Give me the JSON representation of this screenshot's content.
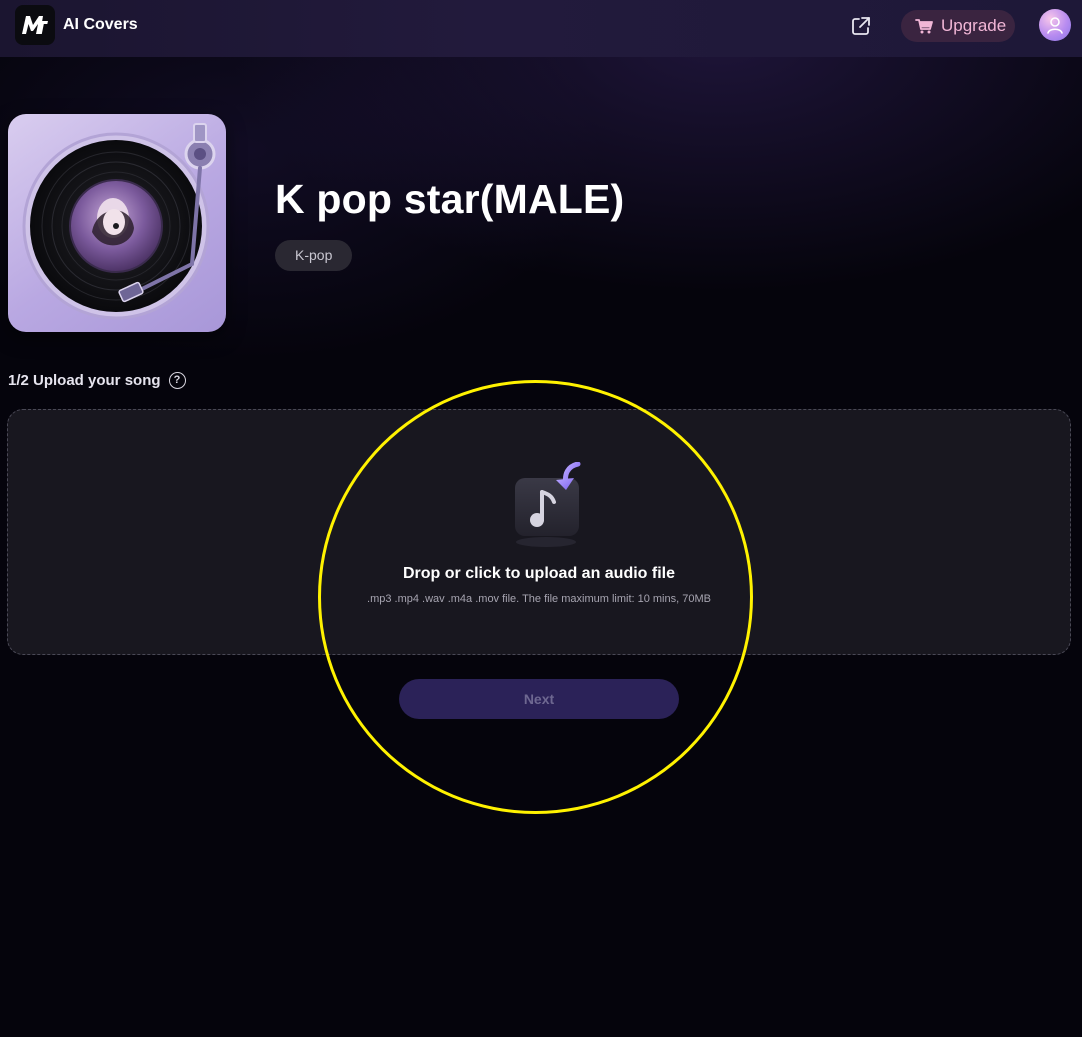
{
  "header": {
    "app_title": "AI Covers",
    "logo_text": "M",
    "upgrade_label": "Upgrade",
    "share_icon": "external-link-icon",
    "cart_icon": "cart-icon",
    "avatar_icon": "user-icon"
  },
  "voice": {
    "title": "K pop star(MALE)",
    "tag": "K-pop",
    "cover_icon": "turntable-record-image"
  },
  "upload": {
    "step_label": "1/2 Upload your song",
    "help_icon_glyph": "?",
    "drop_title": "Drop or click to upload an audio file",
    "drop_hint": ".mp3 .mp4 .wav .m4a .mov file. The file maximum limit: 10 mins, 70MB",
    "upload_icon": "music-note-upload-icon"
  },
  "actions": {
    "next_label": "Next"
  },
  "colors": {
    "background": "#05040c",
    "header": "#1e1838",
    "accent": "#2b2258",
    "upgrade_text": "#f1b6d6",
    "highlight": "#fff200"
  }
}
